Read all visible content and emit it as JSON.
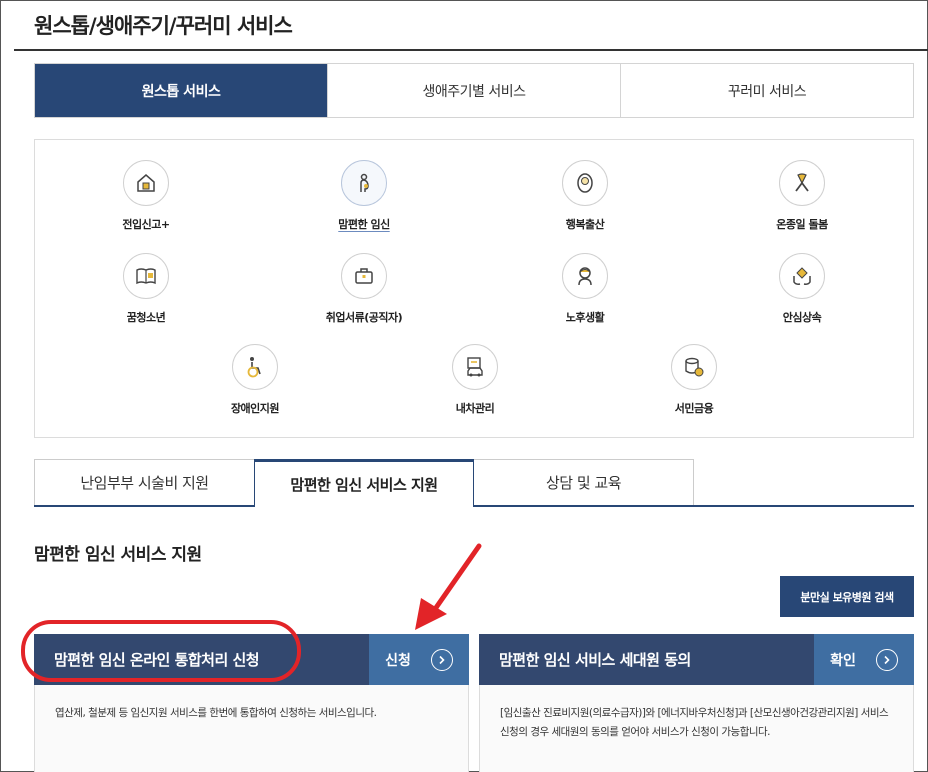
{
  "page": {
    "title": "원스톱/생애주기/꾸러미 서비스"
  },
  "top_tabs": [
    {
      "label": "원스톱 서비스",
      "active": true
    },
    {
      "label": "생애주기별 서비스",
      "active": false
    },
    {
      "label": "꾸러미 서비스",
      "active": false
    }
  ],
  "services": [
    {
      "label": "전입신고+",
      "icon": "house-icon"
    },
    {
      "label": "맘편한 임신",
      "icon": "pregnant-woman-icon"
    },
    {
      "label": "행복출산",
      "icon": "baby-icon"
    },
    {
      "label": "온종일 돌봄",
      "icon": "ribbon-icon"
    },
    {
      "label": "꿈청소년",
      "icon": "book-icon"
    },
    {
      "label": "취업서류(공직자)",
      "icon": "briefcase-icon"
    },
    {
      "label": "노후생활",
      "icon": "elderly-icon"
    },
    {
      "label": "안심상속",
      "icon": "hands-house-icon"
    },
    {
      "label": "장애인지원",
      "icon": "wheelchair-icon"
    },
    {
      "label": "내차관리",
      "icon": "car-document-icon"
    },
    {
      "label": "서민금융",
      "icon": "coins-icon"
    }
  ],
  "sub_tabs": [
    {
      "label": "난임부부 시술비 지원",
      "active": false
    },
    {
      "label": "맘편한 임신 서비스 지원",
      "active": true
    },
    {
      "label": "상담 및 교육",
      "active": false
    }
  ],
  "section": {
    "title": "맘편한 임신 서비스 지원",
    "search_button": "분만실 보유병원 검색"
  },
  "cards": [
    {
      "title": "맘편한 임신 온라인 통합처리 신청",
      "action": "신청",
      "description": "엽산제, 철분제 등 임신지원 서비스를 한번에 통합하여 신청하는 서비스입니다."
    },
    {
      "title": "맘편한 임신 서비스 세대원 동의",
      "action": "확인",
      "description": "[임신출산 진료비지원(의료수급자)]와 [에너지바우처신청]과 [산모신생아건강관리지원] 서비스 신청의 경우 세대원의 동의를 얻어야 서비스가 신청이 가능합니다."
    }
  ],
  "colors": {
    "brand_navy": "#284776",
    "card_title_bg": "#33486f",
    "card_action_bg": "#3f6ea2",
    "annotation_red": "#e22428",
    "icon_gold": "#c9a227"
  }
}
